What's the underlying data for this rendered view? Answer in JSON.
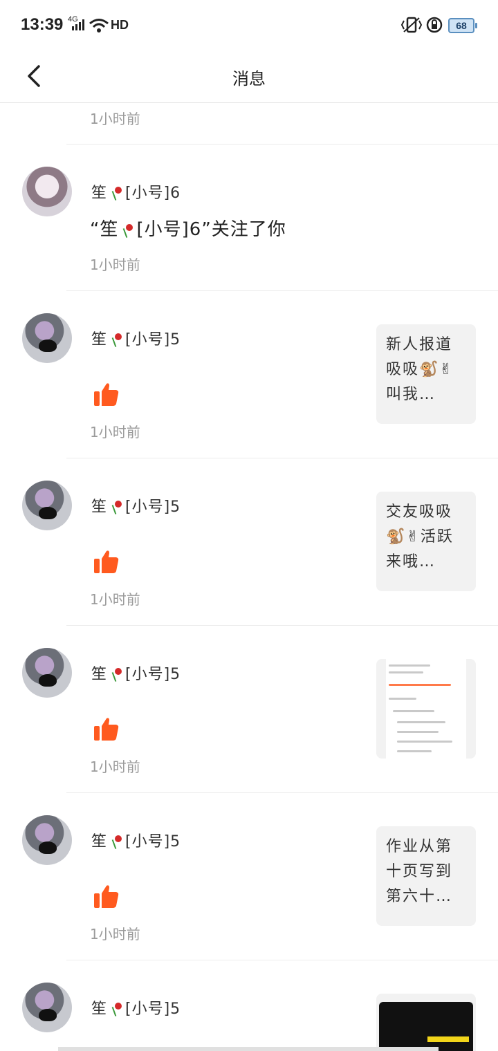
{
  "status_bar": {
    "time": "13:39",
    "network": "4G",
    "hd": "HD",
    "battery": "68"
  },
  "header": {
    "title": "消息"
  },
  "top_partial": {
    "time": "1小时前"
  },
  "notifications": [
    {
      "type": "follow",
      "user_name_prefix": "笙",
      "user_name_suffix": "[小号]6",
      "message_prefix": "“笙",
      "message_suffix": "[小号]6”关注了你",
      "time": "1小时前"
    },
    {
      "type": "like",
      "user_name_prefix": "笙",
      "user_name_suffix": "[小号]5",
      "time": "1小时前",
      "preview_text": "新人报道吸吸🐒✌叫我…"
    },
    {
      "type": "like",
      "user_name_prefix": "笙",
      "user_name_suffix": "[小号]5",
      "time": "1小时前",
      "preview_text": "交友吸吸🐒✌活跃来哦…"
    },
    {
      "type": "like",
      "user_name_prefix": "笙",
      "user_name_suffix": "[小号]5",
      "time": "1小时前",
      "preview_text": ""
    },
    {
      "type": "like",
      "user_name_prefix": "笙",
      "user_name_suffix": "[小号]5",
      "time": "1小时前",
      "preview_text": "作业从第十页写到第六十…"
    },
    {
      "type": "like",
      "user_name_prefix": "笙",
      "user_name_suffix": "[小号]5",
      "time": "",
      "preview_text": ""
    }
  ],
  "icons": {
    "back": "chevron-left-icon",
    "like": "thumbs-up-icon",
    "accent": "#ff5a1f"
  }
}
